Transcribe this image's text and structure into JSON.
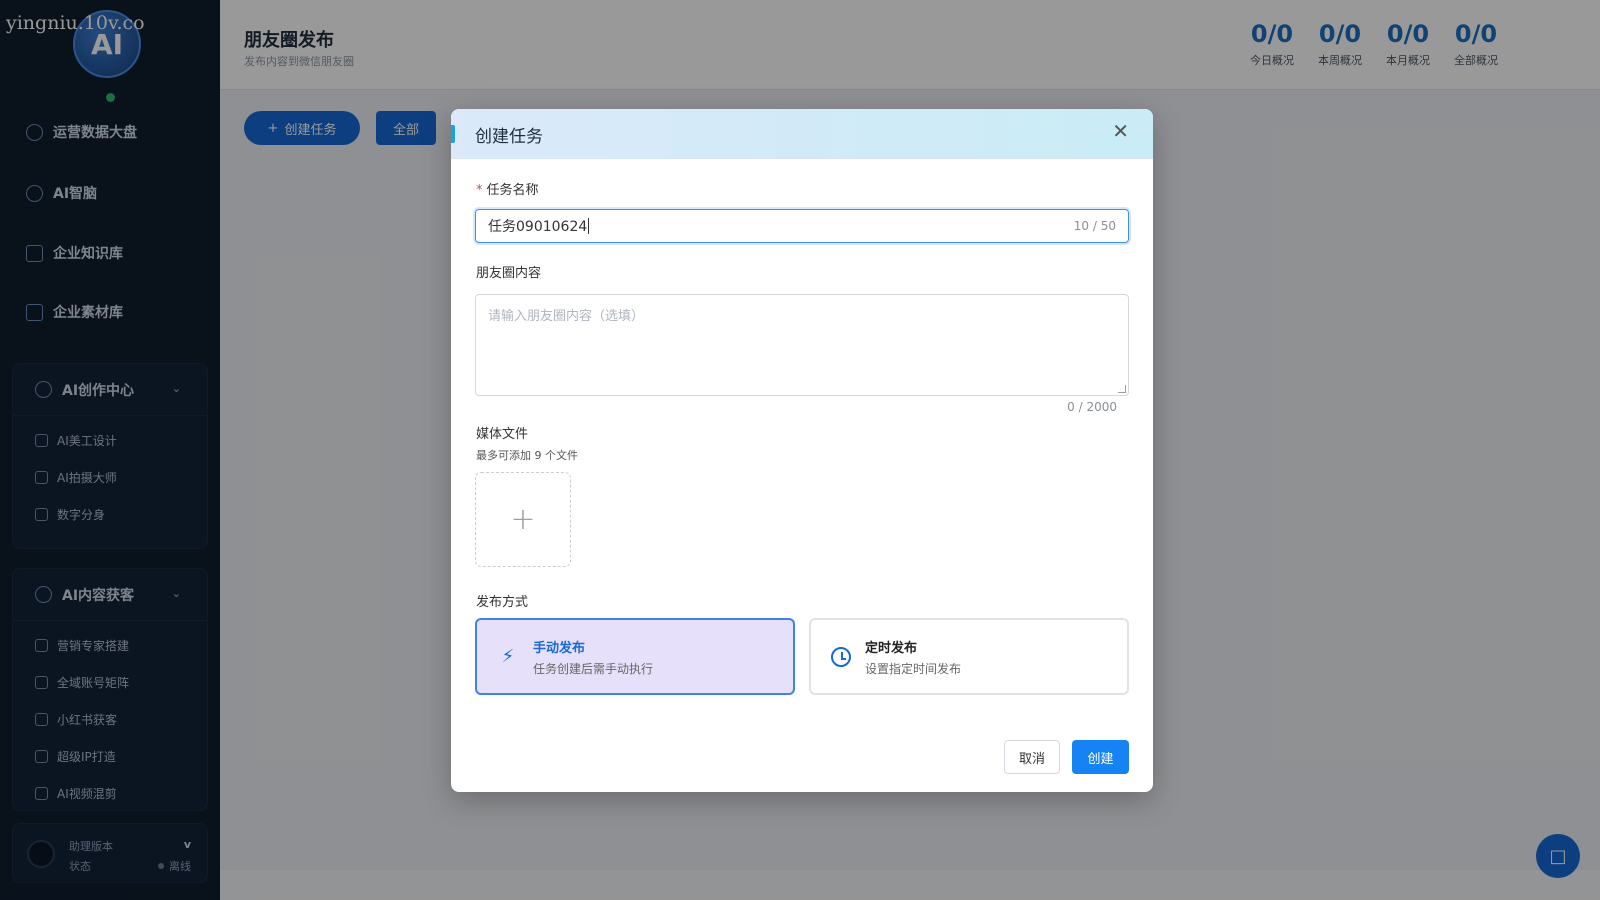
{
  "watermark": "yingniu.10v.co",
  "sidebar": {
    "logo_text": "AI",
    "items": [
      {
        "label": "运营数据大盘",
        "icon": "dashboard-icon"
      },
      {
        "label": "AI智脑",
        "icon": "brain-icon"
      },
      {
        "label": "企业知识库",
        "icon": "building-icon"
      },
      {
        "label": "企业素材库",
        "icon": "image-icon"
      }
    ],
    "groups": [
      {
        "title": "AI创作中心",
        "icon": "bulb-icon",
        "items": [
          {
            "label": "AI美工设计"
          },
          {
            "label": "AI拍摄大师"
          },
          {
            "label": "数字分身"
          }
        ]
      },
      {
        "title": "AI内容获客",
        "icon": "trend-icon",
        "items": [
          {
            "label": "营销专家搭建"
          },
          {
            "label": "全域账号矩阵"
          },
          {
            "label": "小红书获客"
          },
          {
            "label": "超级IP打造"
          },
          {
            "label": "AI视频混剪"
          }
        ]
      }
    ],
    "status": {
      "version_label": "助理版本",
      "version_value": "v",
      "state_label": "状态",
      "state_value": "离线"
    }
  },
  "header": {
    "title": "朋友圈发布",
    "subtitle": "发布内容到微信朋友圈",
    "stats": [
      {
        "value": "0/0",
        "label": "今日概况"
      },
      {
        "value": "0/0",
        "label": "本周概况"
      },
      {
        "value": "0/0",
        "label": "本月概况"
      },
      {
        "value": "0/0",
        "label": "全部概况"
      }
    ]
  },
  "toolbar": {
    "create_label": "创建任务",
    "all_label": "全部"
  },
  "modal": {
    "title": "创建任务",
    "name_label": "任务名称",
    "name_value": "任务09010624",
    "name_count": "10 / 50",
    "content_label": "朋友圈内容",
    "content_placeholder": "请输入朋友圈内容（选填）",
    "content_count": "0 / 2000",
    "media_label": "媒体文件",
    "media_hint": "最多可添加 9 个文件",
    "publish_label": "发布方式",
    "publish_options": [
      {
        "title": "手动发布",
        "desc": "任务创建后需手动执行",
        "selected": true
      },
      {
        "title": "定时发布",
        "desc": "设置指定时间发布",
        "selected": false
      }
    ],
    "cancel_label": "取消",
    "submit_label": "创建"
  },
  "colors": {
    "sidebar_bg": "#0f1d2e",
    "primary": "#1769d6",
    "stat_blue": "#1c6fc0",
    "selected_bg": "#e6e0fb",
    "required": "#e04848"
  }
}
